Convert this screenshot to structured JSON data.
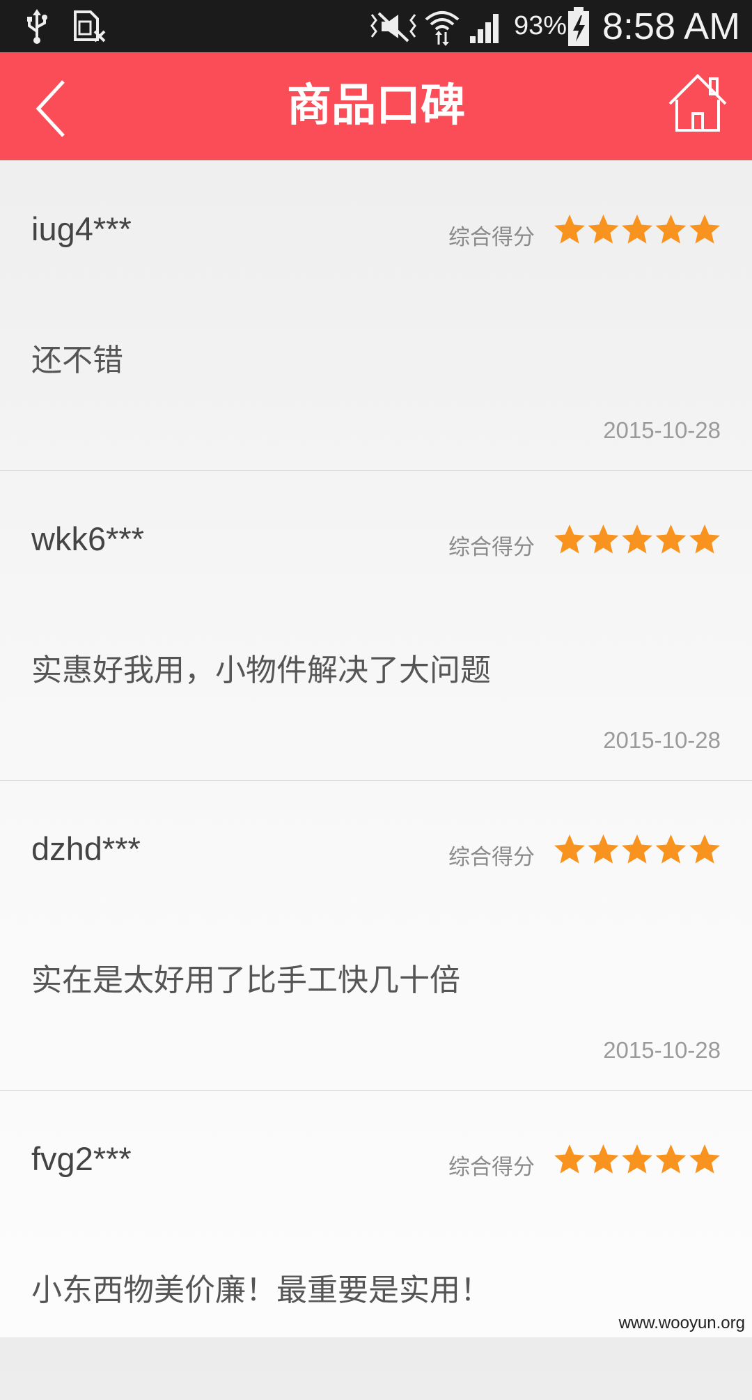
{
  "status_bar": {
    "icons": [
      "usb-icon",
      "sim-card-off-icon",
      "mute-icon",
      "wifi-icon",
      "signal-icon",
      "battery-charging-icon"
    ],
    "battery": "93%",
    "time": "8:58 AM"
  },
  "nav": {
    "title": "商品口碑",
    "back_icon": "chevron-left-icon",
    "home_icon": "home-icon"
  },
  "colors": {
    "accent": "#fb4d57",
    "star": "#f7931e",
    "status_bar": "#1b1b1b"
  },
  "reviews": [
    {
      "user": "iug4***",
      "score_label": "综合得分",
      "rating": 5,
      "content": "还不错",
      "date": "2015-10-28"
    },
    {
      "user": "wkk6***",
      "score_label": "综合得分",
      "rating": 5,
      "content": "实惠好我用，小物件解决了大问题",
      "date": "2015-10-28"
    },
    {
      "user": "dzhd***",
      "score_label": "综合得分",
      "rating": 5,
      "content": "实在是太好用了比手工快几十倍",
      "date": "2015-10-28"
    },
    {
      "user": "fvg2***",
      "score_label": "综合得分",
      "rating": 5,
      "content": "小东西物美价廉！最重要是实用！",
      "date": ""
    }
  ],
  "watermark": "www.wooyun.org"
}
